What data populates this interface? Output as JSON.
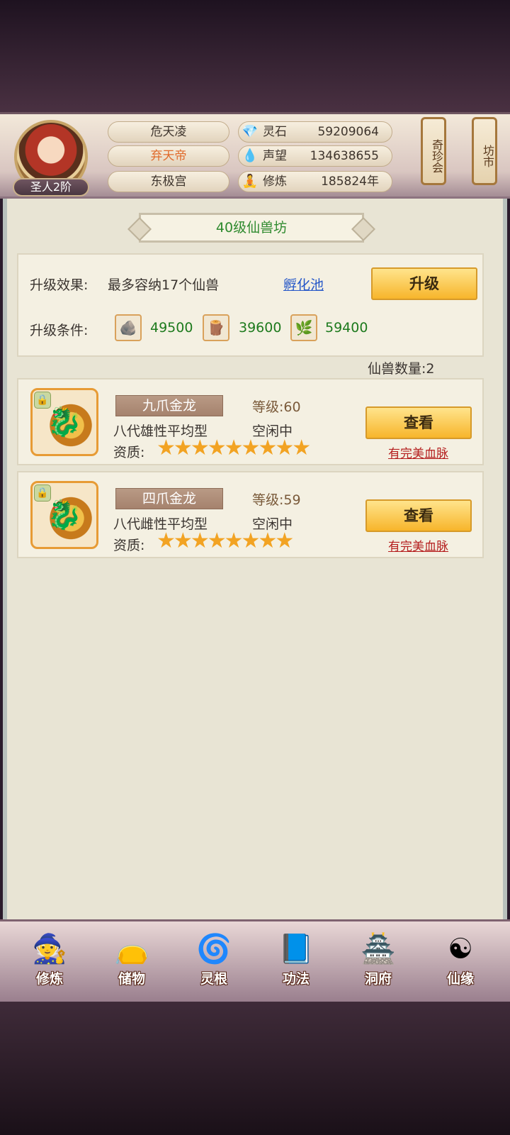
{
  "header": {
    "rank": "圣人2阶",
    "names": [
      "危天凌",
      "弃天帝",
      "东极宫"
    ],
    "stats": [
      {
        "icon": "spirit-stone-icon",
        "glyph": "💎",
        "label": "灵石",
        "value": "59209064"
      },
      {
        "icon": "prestige-icon",
        "glyph": "💧",
        "label": "声望",
        "value": "134638655"
      },
      {
        "icon": "cultivation-icon",
        "glyph": "🧘",
        "label": "修炼",
        "value": "185824年"
      }
    ],
    "shops": [
      "奇珍会",
      "坊市"
    ]
  },
  "page": {
    "title": "40级仙兽坊",
    "upgrade_effect_label": "升级效果:",
    "upgrade_effect_text": "最多容纳17个仙兽",
    "hatch_link": "孵化池",
    "upgrade_button": "升级",
    "condition_label": "升级条件:",
    "resources": [
      {
        "icon": "stone-material-icon",
        "glyph": "🪨",
        "value": "49500"
      },
      {
        "icon": "wood-material-icon",
        "glyph": "🪵",
        "value": "39600"
      },
      {
        "icon": "herb-material-icon",
        "glyph": "🌿",
        "value": "59400"
      }
    ],
    "count_label": "仙兽数量:",
    "count_value": "2"
  },
  "pets": [
    {
      "name": "九爪金龙",
      "level_label": "等级:",
      "level": "60",
      "type": "八代雄性平均型",
      "status": "空闲中",
      "aptitude_label": "资质:",
      "stars": 9,
      "view_button": "查看",
      "bloodline": "有完美血脉"
    },
    {
      "name": "四爪金龙",
      "level_label": "等级:",
      "level": "59",
      "type": "八代雌性平均型",
      "status": "空闲中",
      "aptitude_label": "资质:",
      "stars": 8,
      "view_button": "查看",
      "bloodline": "有完美血脉"
    }
  ],
  "nav": [
    {
      "label": "修炼",
      "icon": "meditation-icon",
      "glyph": "🧙"
    },
    {
      "label": "储物",
      "icon": "storage-bag-icon",
      "glyph": "👝"
    },
    {
      "label": "灵根",
      "icon": "spirit-root-icon",
      "glyph": "🌀"
    },
    {
      "label": "功法",
      "icon": "skill-book-icon",
      "glyph": "📘"
    },
    {
      "label": "洞府",
      "icon": "cave-mansion-icon",
      "glyph": "🏯"
    },
    {
      "label": "仙缘",
      "icon": "fortune-icon",
      "glyph": "☯"
    }
  ]
}
